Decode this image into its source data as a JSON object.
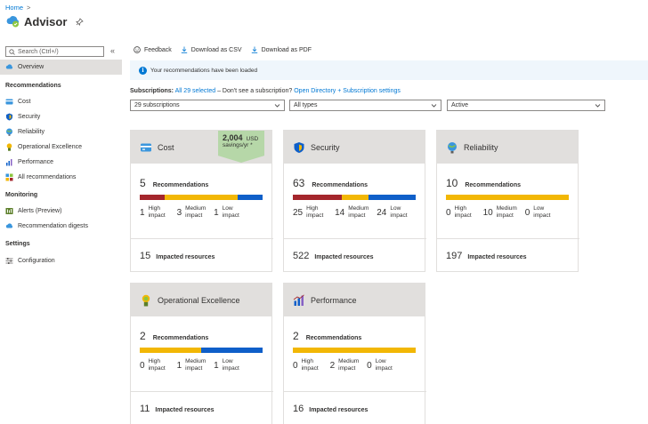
{
  "breadcrumb": {
    "home": "Home",
    "sep": ">"
  },
  "app": {
    "title": "Advisor"
  },
  "sidebar": {
    "search_placeholder": "Search (Ctrl+/)",
    "collapse": "«",
    "overview": "Overview",
    "sections": {
      "recommendations": "Recommendations",
      "monitoring": "Monitoring",
      "settings": "Settings"
    },
    "items": {
      "cost": "Cost",
      "security": "Security",
      "reliability": "Reliability",
      "operational": "Operational Excellence",
      "performance": "Performance",
      "all": "All recommendations",
      "alerts": "Alerts (Preview)",
      "digests": "Recommendation digests",
      "configuration": "Configuration"
    }
  },
  "toolbar": {
    "feedback": "Feedback",
    "csv": "Download as CSV",
    "pdf": "Download as PDF"
  },
  "info": {
    "message": "Your recommendations have been loaded"
  },
  "subscriptions": {
    "label": "Subscriptions:",
    "selected": "All 29 selected",
    "dash": "– Don't see a subscription?",
    "link": "Open Directory + Subscription settings"
  },
  "filters": {
    "subscriptions": "29 subscriptions",
    "types": "All types",
    "status": "Active"
  },
  "labels": {
    "recommendations": "Recommendations",
    "high": "High impact",
    "medium": "Medium impact",
    "low": "Low impact",
    "impacted": "Impacted resources"
  },
  "colors": {
    "high": "#a4262c",
    "medium": "#f2b705",
    "low": "#0f5fc9"
  },
  "cards": {
    "cost": {
      "title": "Cost",
      "count": "5",
      "high": "1",
      "medium": "3",
      "low": "1",
      "resources": "15",
      "savings_amount": "2,004",
      "savings_currency": "USD",
      "savings_period": "savings/yr *"
    },
    "security": {
      "title": "Security",
      "count": "63",
      "high": "25",
      "medium": "14",
      "low": "24",
      "resources": "522"
    },
    "reliability": {
      "title": "Reliability",
      "count": "10",
      "high": "0",
      "medium": "10",
      "low": "0",
      "resources": "197"
    },
    "operational": {
      "title": "Operational Excellence",
      "count": "2",
      "high": "0",
      "medium": "1",
      "low": "1",
      "resources": "11"
    },
    "performance": {
      "title": "Performance",
      "count": "2",
      "high": "0",
      "medium": "2",
      "low": "0",
      "resources": "16"
    }
  }
}
